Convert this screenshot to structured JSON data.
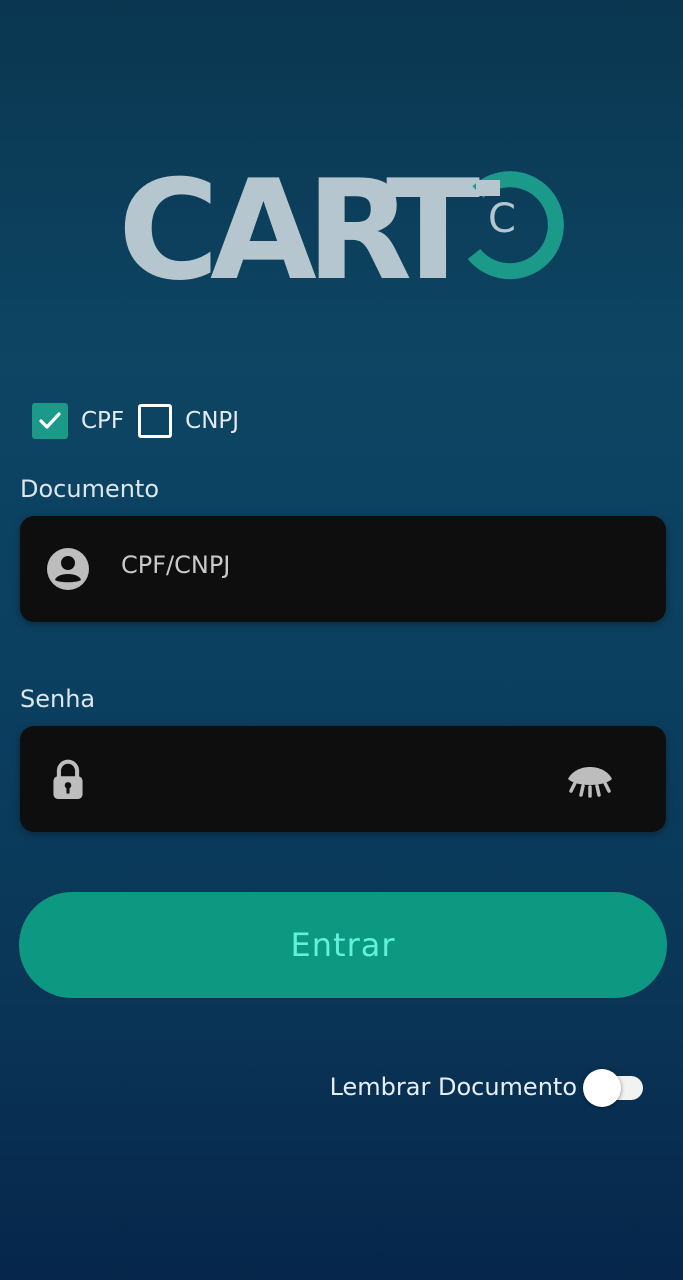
{
  "logo": {
    "text": "CARTC",
    "letters": [
      "C",
      "A",
      "R",
      "T"
    ],
    "emblem_letter": "C",
    "letter_color": "#b5c6cf",
    "accent_color": "#1b9a8a"
  },
  "document_type": {
    "options": [
      {
        "label": "CPF",
        "checked": true
      },
      {
        "label": "CNPJ",
        "checked": false
      }
    ]
  },
  "documento": {
    "label": "Documento",
    "placeholder": "CPF/CNPJ",
    "icon": "account-circle-icon"
  },
  "senha": {
    "label": "Senha",
    "icon": "lock-icon",
    "toggle_icon": "eye-closed-icon",
    "value": ""
  },
  "entrar_button": {
    "label": "Entrar",
    "color": "#0d9882",
    "text_color": "#5ff2dc"
  },
  "remember": {
    "label": "Lembrar Documento",
    "enabled": false
  }
}
